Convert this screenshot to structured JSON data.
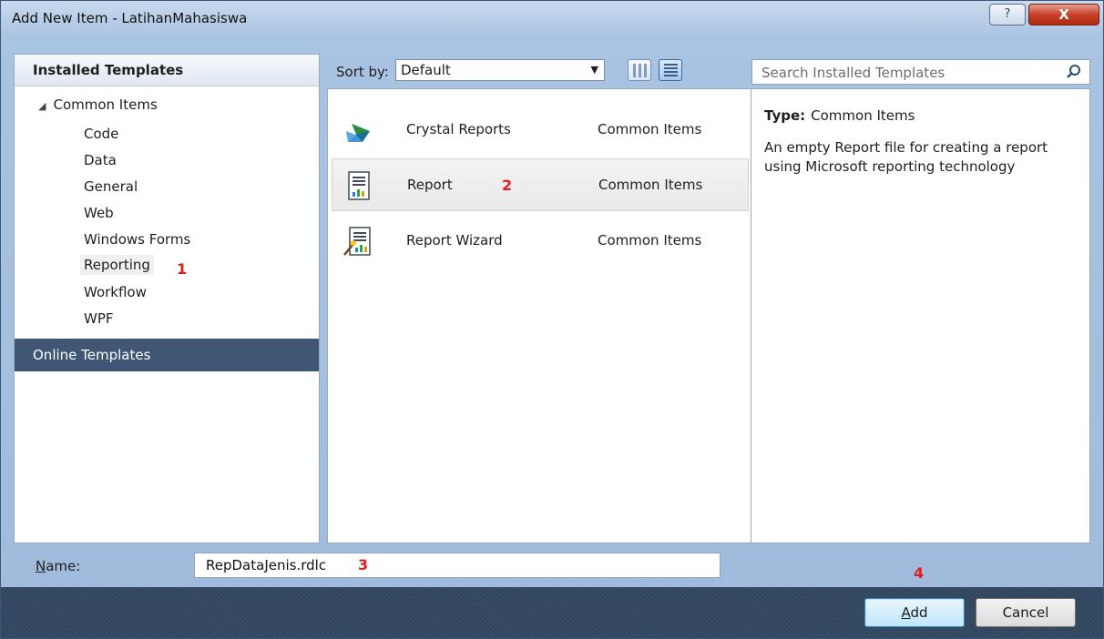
{
  "window": {
    "title": "Add New Item - LatihanMahasiswa",
    "help_label": "?",
    "close_label": "X"
  },
  "left_pane": {
    "installed_header": "Installed Templates",
    "tree_root": "Common Items",
    "tree_items": [
      {
        "label": "Code",
        "selected": false
      },
      {
        "label": "Data",
        "selected": false
      },
      {
        "label": "General",
        "selected": false
      },
      {
        "label": "Web",
        "selected": false
      },
      {
        "label": "Windows Forms",
        "selected": false
      },
      {
        "label": "Reporting",
        "selected": true
      },
      {
        "label": "Workflow",
        "selected": false
      },
      {
        "label": "WPF",
        "selected": false
      }
    ],
    "online_header": "Online Templates"
  },
  "toolbar": {
    "sort_label": "Sort by:",
    "sort_value": "Default",
    "search_placeholder": "Search Installed Templates"
  },
  "templates": [
    {
      "name": "Crystal Reports",
      "category": "Common Items",
      "icon": "crystal-reports-icon",
      "selected": false
    },
    {
      "name": "Report",
      "category": "Common Items",
      "icon": "report-icon",
      "selected": true
    },
    {
      "name": "Report Wizard",
      "category": "Common Items",
      "icon": "report-wizard-icon",
      "selected": false
    }
  ],
  "details": {
    "type_label": "Type:",
    "type_value": "Common Items",
    "description": "An empty Report file for creating a report using Microsoft reporting technology"
  },
  "name_field": {
    "label_prefix": "",
    "label_access_key": "N",
    "label_rest": "ame:",
    "value": "RepDataJenis.rdlc"
  },
  "buttons": {
    "add_access_key": "A",
    "add_rest": "dd",
    "cancel": "Cancel"
  },
  "annotations": {
    "marker_1": "1",
    "marker_2": "2",
    "marker_3": "3",
    "marker_4": "4",
    "color": "#e31b1b"
  }
}
